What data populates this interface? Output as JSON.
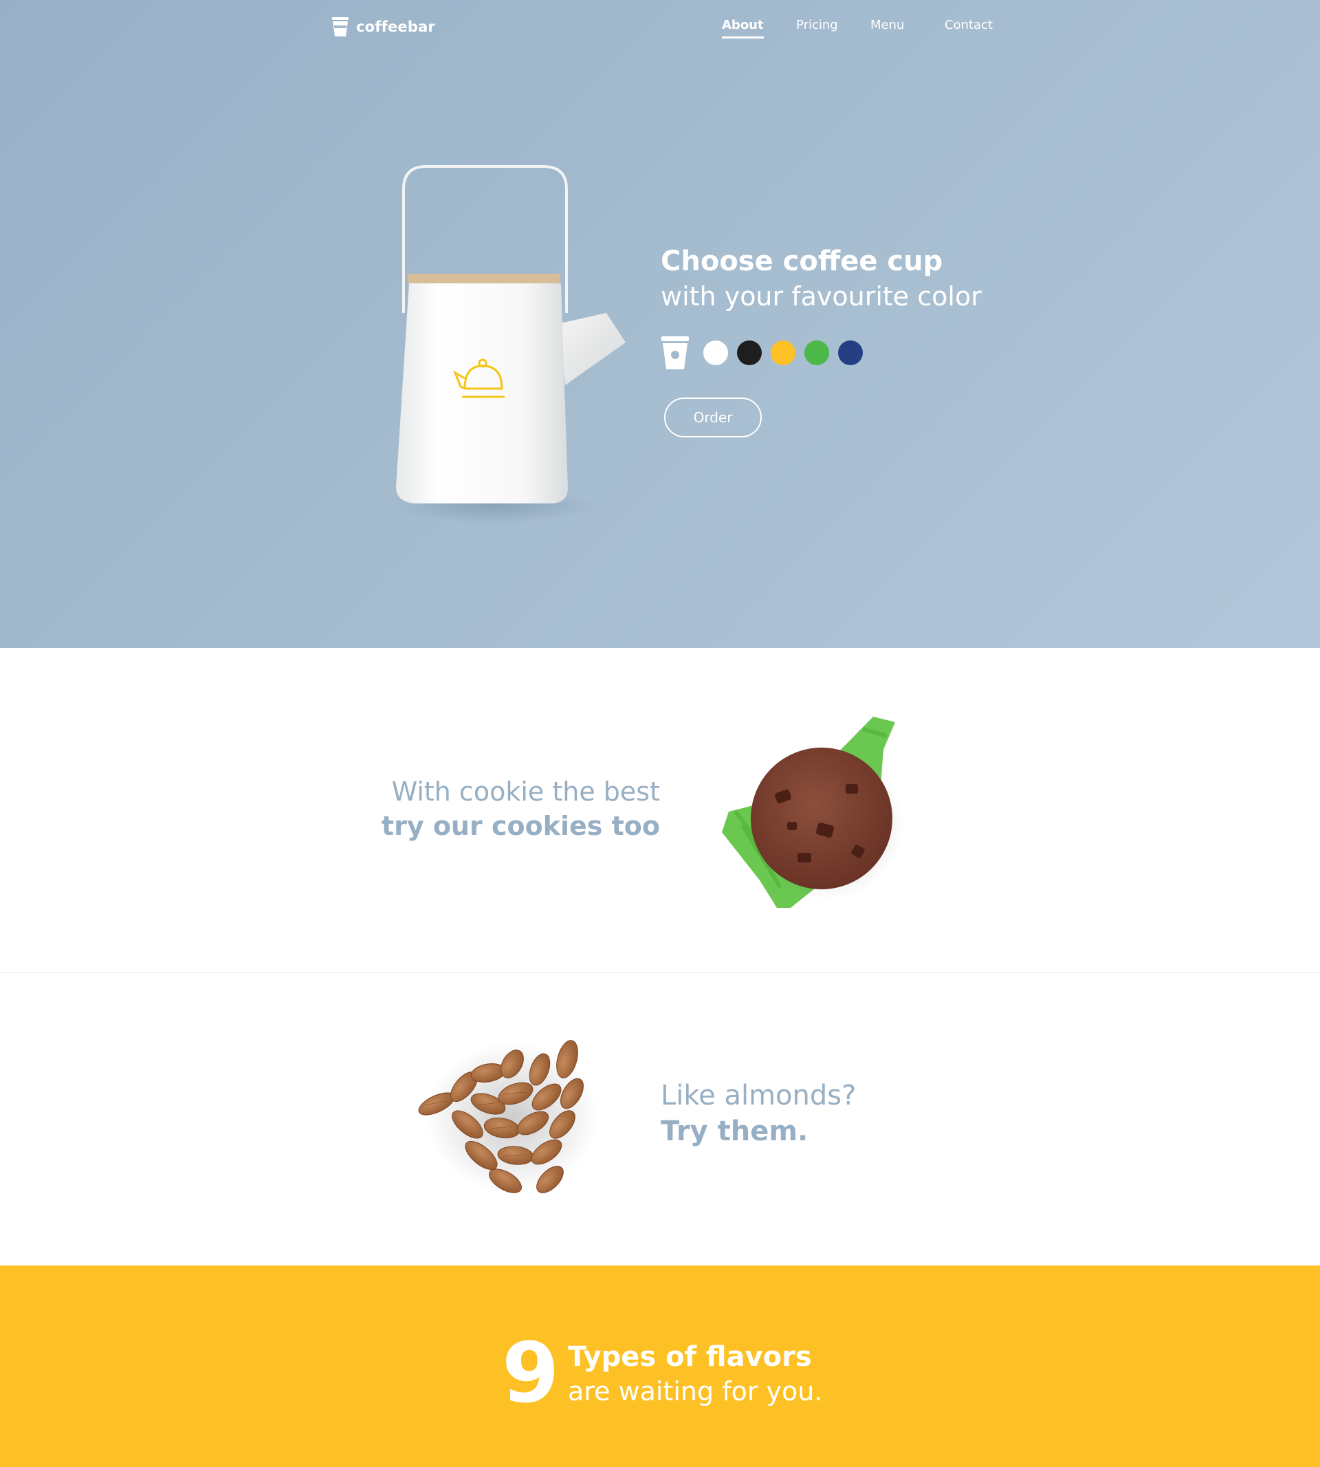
{
  "brand": {
    "name": "coffeebar",
    "logo_icon": "cup-icon"
  },
  "nav": {
    "items": [
      {
        "label": "About",
        "active": true
      },
      {
        "label": "Pricing",
        "active": false
      },
      {
        "label": "Menu",
        "active": false
      },
      {
        "label": "Contact",
        "active": false
      }
    ]
  },
  "hero": {
    "title_bold": "Choose coffee cup",
    "title_light": "with your favourite color",
    "cup_icon": "cup-icon",
    "kettle_icon": "kettle-icon",
    "swatches": [
      {
        "name": "white",
        "color": "#ffffff"
      },
      {
        "name": "black",
        "color": "#1e1e1e"
      },
      {
        "name": "yellow",
        "color": "#fec125"
      },
      {
        "name": "green",
        "color": "#4cb848"
      },
      {
        "name": "blue",
        "color": "#253f85"
      }
    ],
    "order_label": "Order",
    "background_color": "#a3b9cd",
    "accent_color": "#f5c518"
  },
  "cookies": {
    "line1": "With cookie the best",
    "line2": "try our cookies too",
    "text_color": "#97afc4"
  },
  "almonds": {
    "line1": "Like almonds?",
    "line2": "Try them."
  },
  "flavors": {
    "number": "9",
    "title": "Types of flavors",
    "subtitle": "are waiting for you.",
    "background_color": "#fec125"
  }
}
